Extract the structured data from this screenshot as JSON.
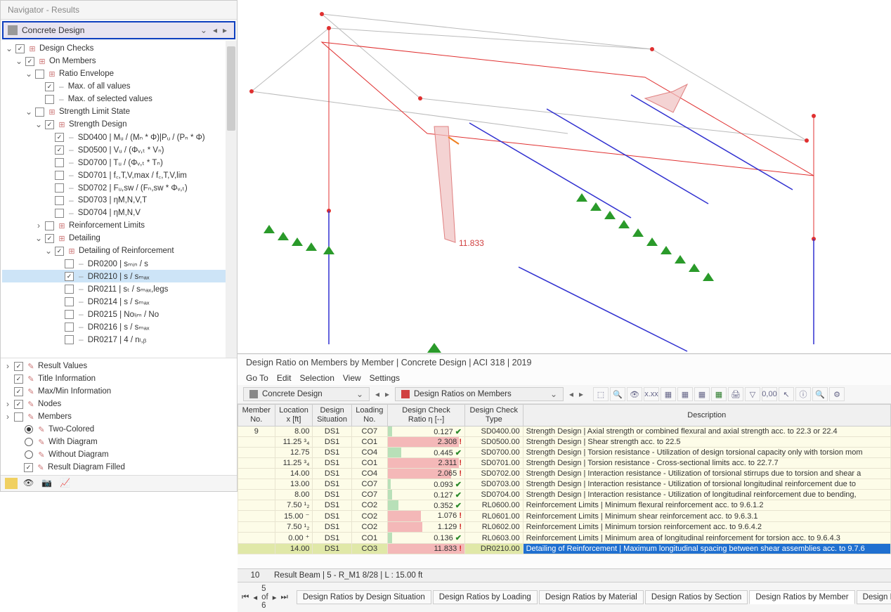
{
  "navigator": {
    "title": "Navigator - Results",
    "dropdown": "Concrete Design",
    "tree": [
      {
        "indent": 0,
        "toggle": "v",
        "check": true,
        "icon": "⊞",
        "label": "Design Checks"
      },
      {
        "indent": 1,
        "toggle": "v",
        "check": true,
        "icon": "⊞",
        "label": "On Members"
      },
      {
        "indent": 2,
        "toggle": "v",
        "check": false,
        "icon": "⊞",
        "label": "Ratio Envelope"
      },
      {
        "indent": 3,
        "toggle": "",
        "check": true,
        "icon": "",
        "dash": true,
        "label": "Max. of all values"
      },
      {
        "indent": 3,
        "toggle": "",
        "check": false,
        "icon": "",
        "dash": true,
        "label": "Max. of selected values"
      },
      {
        "indent": 2,
        "toggle": "v",
        "check": false,
        "icon": "⊞",
        "label": "Strength Limit State"
      },
      {
        "indent": 3,
        "toggle": "v",
        "check": true,
        "icon": "⊞",
        "label": "Strength Design"
      },
      {
        "indent": 4,
        "toggle": "",
        "check": true,
        "icon": "",
        "dash": true,
        "label": "SD0400 | Mᵤ / (Mₙ * Φ)|Pᵤ / (Pₙ * Φ)"
      },
      {
        "indent": 4,
        "toggle": "",
        "check": true,
        "icon": "",
        "dash": true,
        "label": "SD0500 | Vᵤ / (Φᵥ,ₜ * Vₙ)"
      },
      {
        "indent": 4,
        "toggle": "",
        "check": false,
        "icon": "",
        "dash": true,
        "label": "SD0700 | Tᵤ / (Φᵥ,ₜ * Tₙ)"
      },
      {
        "indent": 4,
        "toggle": "",
        "check": false,
        "icon": "",
        "dash": true,
        "label": "SD0701 | f꜀,T,V,max / f꜀,T,V,lim"
      },
      {
        "indent": 4,
        "toggle": "",
        "check": false,
        "icon": "",
        "dash": true,
        "label": "SD0702 | Fᵤ,sw / (Fₙ,sw * Φᵥ,ₜ)"
      },
      {
        "indent": 4,
        "toggle": "",
        "check": false,
        "icon": "",
        "dash": true,
        "label": "SD0703 | ηM,N,V,T"
      },
      {
        "indent": 4,
        "toggle": "",
        "check": false,
        "icon": "",
        "dash": true,
        "label": "SD0704 | ηM,N,V"
      },
      {
        "indent": 3,
        "toggle": ">",
        "check": false,
        "icon": "⊞",
        "label": "Reinforcement Limits"
      },
      {
        "indent": 3,
        "toggle": "v",
        "check": true,
        "icon": "⊞",
        "label": "Detailing"
      },
      {
        "indent": 4,
        "toggle": "v",
        "check": true,
        "icon": "⊞",
        "label": "Detailing of Reinforcement"
      },
      {
        "indent": 5,
        "toggle": "",
        "check": false,
        "icon": "",
        "dash": true,
        "label": "DR0200 | sₘᵢₙ / s"
      },
      {
        "indent": 5,
        "toggle": "",
        "check": true,
        "icon": "",
        "dash": true,
        "label": "DR0210 | s / sₘₐₓ",
        "sel": true
      },
      {
        "indent": 5,
        "toggle": "",
        "check": false,
        "icon": "",
        "dash": true,
        "label": "DR0211 | sₜ / sₘₐₓ,legs"
      },
      {
        "indent": 5,
        "toggle": "",
        "check": false,
        "icon": "",
        "dash": true,
        "label": "DR0214 | s / sₘₐₓ"
      },
      {
        "indent": 5,
        "toggle": "",
        "check": false,
        "icon": "",
        "dash": true,
        "label": "DR0215 | Noₗᵢₘ / No"
      },
      {
        "indent": 5,
        "toggle": "",
        "check": false,
        "icon": "",
        "dash": true,
        "label": "DR0216 | s / sₘₐₓ"
      },
      {
        "indent": 5,
        "toggle": "",
        "check": false,
        "icon": "",
        "dash": true,
        "label": "DR0217 | 4 / nₗ,ᵦ"
      }
    ],
    "bottom": [
      {
        "indent": 0,
        "toggle": ">",
        "check": true,
        "icon": "✎",
        "label": "Result Values"
      },
      {
        "indent": 0,
        "toggle": "",
        "check": true,
        "icon": "✎",
        "label": "Title Information"
      },
      {
        "indent": 0,
        "toggle": "",
        "check": true,
        "icon": "✎",
        "label": "Max/Min Information"
      },
      {
        "indent": 0,
        "toggle": ">",
        "check": true,
        "icon": "✎",
        "label": "Nodes"
      },
      {
        "indent": 0,
        "toggle": ">",
        "check": false,
        "icon": "✎",
        "label": "Members"
      },
      {
        "indent": 1,
        "radio": true,
        "on": true,
        "icon": "✎",
        "label": "Two-Colored"
      },
      {
        "indent": 1,
        "radio": true,
        "on": false,
        "icon": "✎",
        "label": "With Diagram"
      },
      {
        "indent": 1,
        "radio": true,
        "on": false,
        "icon": "✎",
        "label": "Without Diagram"
      },
      {
        "indent": 1,
        "check": true,
        "icon": "✎",
        "label": "Result Diagram Filled"
      }
    ]
  },
  "viewport": {
    "annotation": "11.833"
  },
  "results": {
    "title": "Design Ratio on Members by Member | Concrete Design | ACI 318 | 2019",
    "menu": [
      "Go To",
      "Edit",
      "Selection",
      "View",
      "Settings"
    ],
    "dropdown1": "Concrete Design",
    "dropdown2": "Design Ratios on Members",
    "headers": {
      "member": "Member\nNo.",
      "location": "Location\nx [ft]",
      "situation": "Design\nSituation",
      "loading": "Loading\nNo.",
      "ratio": "Design Check\nRatio η [--]",
      "type": "Design Check\nType",
      "desc": "Description"
    },
    "member_no": "9",
    "rows": [
      {
        "loc": "8.00",
        "sit": "DS1",
        "load": "CO7",
        "ratio": 0.127,
        "ok": true,
        "type": "SD0400.00",
        "desc": "Strength Design | Axial strength or combined flexural and axial strength acc. to 22.3 or 22.4"
      },
      {
        "loc": "11.25 ³₄",
        "sit": "DS1",
        "load": "CO1",
        "ratio": 2.308,
        "ok": false,
        "type": "SD0500.00",
        "desc": "Strength Design | Shear strength acc. to 22.5"
      },
      {
        "loc": "12.75",
        "sit": "DS1",
        "load": "CO4",
        "ratio": 0.445,
        "ok": true,
        "type": "SD0700.00",
        "desc": "Strength Design | Torsion resistance - Utilization of design torsional capacity only with torsion mom"
      },
      {
        "loc": "11.25 ³₄",
        "sit": "DS1",
        "load": "CO1",
        "ratio": 2.311,
        "ok": false,
        "type": "SD0701.00",
        "desc": "Strength Design | Torsion resistance - Cross-sectional limits acc. to 22.7.7"
      },
      {
        "loc": "14.00",
        "sit": "DS1",
        "load": "CO4",
        "ratio": 2.065,
        "ok": false,
        "type": "SD0702.00",
        "desc": "Strength Design | Interaction resistance - Utilization of torsional stirrups due to torsion and shear a"
      },
      {
        "loc": "13.00",
        "sit": "DS1",
        "load": "CO7",
        "ratio": 0.093,
        "ok": true,
        "type": "SD0703.00",
        "desc": "Strength Design | Interaction resistance - Utilization of torsional longitudinal reinforcement due to"
      },
      {
        "loc": "8.00",
        "sit": "DS1",
        "load": "CO7",
        "ratio": 0.127,
        "ok": true,
        "type": "SD0704.00",
        "desc": "Strength Design | Interaction resistance - Utilization of longitudinal reinforcement due to bending,"
      },
      {
        "loc": "7.50 ¹₂",
        "sit": "DS1",
        "load": "CO2",
        "ratio": 0.352,
        "ok": true,
        "type": "RL0600.00",
        "desc": "Reinforcement Limits | Minimum flexural reinforcement acc. to 9.6.1.2"
      },
      {
        "loc": "15.00 ⁻",
        "sit": "DS1",
        "load": "CO2",
        "ratio": 1.076,
        "ok": false,
        "type": "RL0601.00",
        "desc": "Reinforcement Limits | Minimum shear reinforcement acc. to 9.6.3.1"
      },
      {
        "loc": "7.50 ¹₂",
        "sit": "DS1",
        "load": "CO2",
        "ratio": 1.129,
        "ok": false,
        "type": "RL0602.00",
        "desc": "Reinforcement Limits | Minimum torsion reinforcement acc. to 9.6.4.2"
      },
      {
        "loc": "0.00 ⁺",
        "sit": "DS1",
        "load": "CO1",
        "ratio": 0.136,
        "ok": true,
        "type": "RL0603.00",
        "desc": "Reinforcement Limits | Minimum area of longitudinal reinforcement for torsion acc. to 9.6.4.3"
      },
      {
        "loc": "14.00",
        "sit": "DS1",
        "load": "CO3",
        "ratio": 11.833,
        "ok": false,
        "type": "DR0210.00",
        "desc": "Detailing of Reinforcement | Maximum longitudinal spacing between shear assemblies acc. to 9.7.6",
        "hilite": true
      }
    ],
    "status_no": "10",
    "status_text": "Result Beam | 5 - R_M1 8/28 | L : 15.00 ft",
    "pager": "5 of 6",
    "tabs": [
      "Design Ratios by Design Situation",
      "Design Ratios by Loading",
      "Design Ratios by Material",
      "Design Ratios by Section",
      "Design Ratios by Member",
      "Design Ratios by Location"
    ],
    "active_tab": 4
  }
}
